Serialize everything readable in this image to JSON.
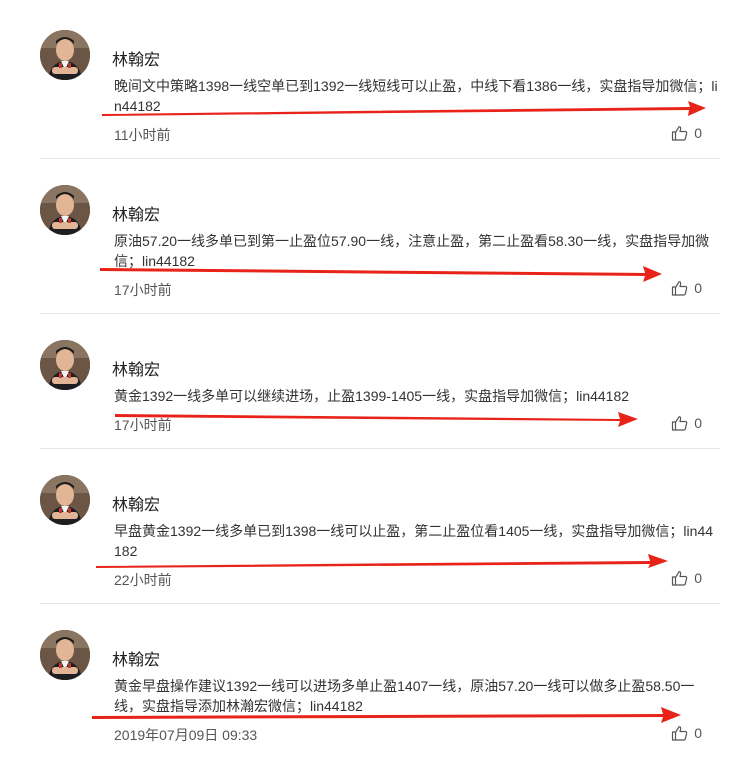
{
  "colors": {
    "accent_arrow": "#e8231a",
    "separator": "#e6e6e6",
    "text": "#333333"
  },
  "posts": [
    {
      "author": "林翰宏",
      "content": "晚间文中策略1398一线空单已到1392一线短线可以止盈，中线下看1386一线，实盘指导加微信；lin44182",
      "time": "11小时前",
      "likes": "0"
    },
    {
      "author": "林翰宏",
      "content": "原油57.20一线多单已到第一止盈位57.90一线，注意止盈，第二止盈看58.30一线，实盘指导加微信；lin44182",
      "time": "17小时前",
      "likes": "0"
    },
    {
      "author": "林翰宏",
      "content": "黄金1392一线多单可以继续进场，止盈1399-1405一线，实盘指导加微信；lin44182",
      "time": "17小时前",
      "likes": "0"
    },
    {
      "author": "林翰宏",
      "content": "早盘黄金1392一线多单已到1398一线可以止盈，第二止盈位看1405一线，实盘指导加微信；lin44182",
      "time": "22小时前",
      "likes": "0"
    },
    {
      "author": "林翰宏",
      "content": "黄金早盘操作建议1392一线可以进场多单止盈1407一线，原油57.20一线可以做多止盈58.50一线，实盘指导添加林瀚宏微信；lin44182",
      "time": "2019年07月09日 09:33",
      "likes": "0"
    }
  ]
}
